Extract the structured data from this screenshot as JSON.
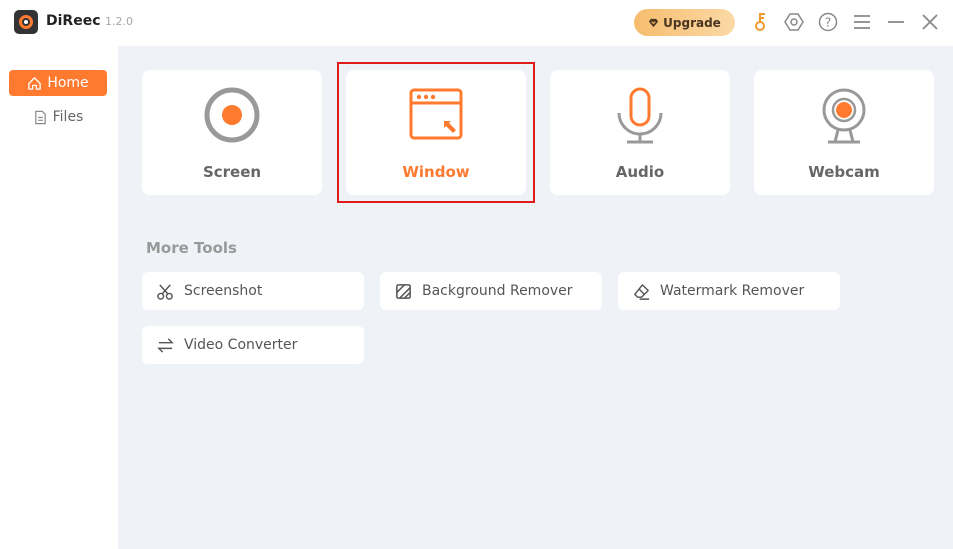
{
  "app": {
    "name": "DiReec",
    "version": "1.2.0",
    "logo_icon": "record-logo-icon"
  },
  "titlebar": {
    "upgrade_label": "Upgrade",
    "icons": [
      "key-icon",
      "settings-icon",
      "help-icon",
      "menu-icon",
      "minimize-icon",
      "close-icon"
    ]
  },
  "sidebar": {
    "items": [
      {
        "label": "Home",
        "icon": "home-icon",
        "active": true
      },
      {
        "label": "Files",
        "icon": "file-icon",
        "active": false
      }
    ]
  },
  "modes": [
    {
      "label": "Screen",
      "icon": "screen-record-icon",
      "selected": false
    },
    {
      "label": "Window",
      "icon": "window-icon",
      "selected": true
    },
    {
      "label": "Audio",
      "icon": "microphone-icon",
      "selected": false
    },
    {
      "label": "Webcam",
      "icon": "webcam-icon",
      "selected": false
    }
  ],
  "more_tools": {
    "title": "More Tools",
    "items": [
      {
        "label": "Screenshot",
        "icon": "scissors-icon"
      },
      {
        "label": "Background Remover",
        "icon": "background-remover-icon"
      },
      {
        "label": "Watermark Remover",
        "icon": "eraser-icon"
      },
      {
        "label": "Video Converter",
        "icon": "convert-arrows-icon"
      }
    ]
  },
  "colors": {
    "accent": "#ff7a2f",
    "selection_border": "#e01b1b",
    "main_bg": "#eff3f8",
    "upgrade_gradient_start": "#f6bd6e"
  }
}
